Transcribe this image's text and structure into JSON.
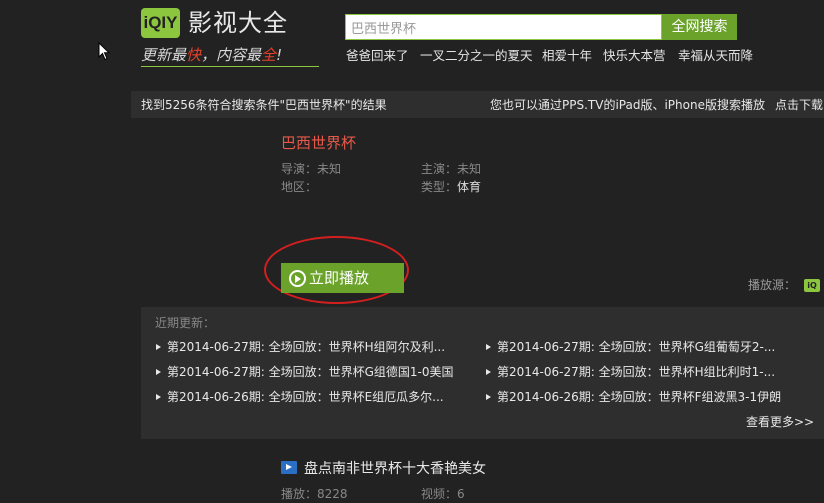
{
  "header": {
    "logo_text": "iQIY",
    "site_title": "影视大全",
    "slogan_parts": [
      "更新最",
      "快",
      "，内容最",
      "全",
      "!"
    ],
    "search": {
      "value": "巴西世界杯",
      "button_label": "全网搜索"
    },
    "hot_searches": [
      "爸爸回来了",
      "一叉二分之一的夏天",
      "相爱十年",
      "快乐大本营",
      "幸福从天而降"
    ]
  },
  "result_bar": {
    "summary": "找到5256条符合搜索条件\"巴西世界杯\"的结果",
    "ipad_note": "您也可以通过PPS.TV的iPad版、iPhone版搜索播放",
    "download": "点击下载"
  },
  "item": {
    "title": "巴西世界杯",
    "director_label": "导演：",
    "director": "未知",
    "actor_label": "主演：",
    "actor": "未知",
    "region_label": "地区：",
    "region": "",
    "type_label": "类型：",
    "type": "体育",
    "play_label": "立即播放",
    "source_label": "播放源：",
    "source_icon": "iqiyi-logo-icon"
  },
  "updates": {
    "label": "近期更新：",
    "episodes": [
      "第2014-06-27期: 全场回放：世界杯H组阿尔及利...",
      "第2014-06-27期: 全场回放：世界杯G组葡萄牙2-...",
      "第2014-06-27期: 全场回放：世界杯G组德国1-0美国",
      "第2014-06-27期: 全场回放：世界杯H组比利时1-...",
      "第2014-06-26期: 全场回放：世界杯E组厄瓜多尔...",
      "第2014-06-26期: 全场回放：世界杯F组波黑3-1伊朗"
    ],
    "more_label": "查看更多>>"
  },
  "item2": {
    "title": "盘点南非世界杯十大香艳美女",
    "plays_label": "播放：",
    "plays": "8228",
    "videos_label": "视频：",
    "videos": "6"
  },
  "colors": {
    "accent_green": "#6aa22a",
    "title_red": "#e8594a",
    "annotation_red": "#d41f1f",
    "background": "#222222"
  }
}
